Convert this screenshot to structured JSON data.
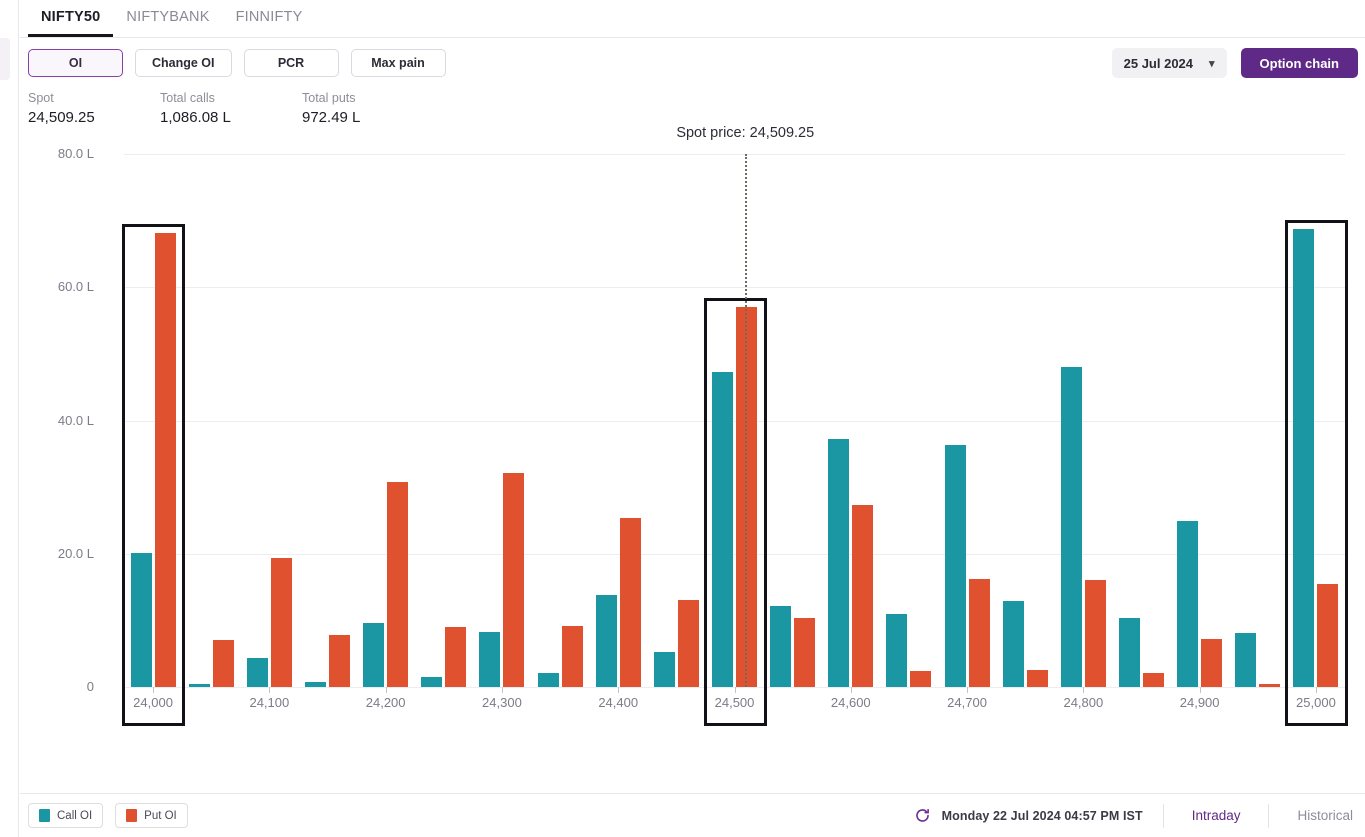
{
  "tabs": [
    {
      "label": "NIFTY50",
      "active": true
    },
    {
      "label": "NIFTYBANK",
      "active": false
    },
    {
      "label": "FINNIFTY",
      "active": false
    }
  ],
  "toolbar": {
    "segments": [
      {
        "label": "OI",
        "active": true
      },
      {
        "label": "Change OI",
        "active": false
      },
      {
        "label": "PCR",
        "active": false
      },
      {
        "label": "Max pain",
        "active": false
      }
    ],
    "date_value": "25 Jul 2024",
    "caret_icon": "chevron-down-icon",
    "option_chain_label": "Option chain"
  },
  "stats": [
    {
      "label": "Spot",
      "value": "24,509.25"
    },
    {
      "label": "Total calls",
      "value": "1,086.08 L"
    },
    {
      "label": "Total puts",
      "value": "972.49 L"
    }
  ],
  "footer": {
    "legend": [
      {
        "label": "Call OI",
        "color": "#1a97a3"
      },
      {
        "label": "Put OI",
        "color": "#e0512f"
      }
    ],
    "refresh_icon": "refresh-icon",
    "timestamp": "Monday 22 Jul 2024 04:57 PM IST",
    "links": [
      {
        "label": "Intraday",
        "active": true
      },
      {
        "label": "Historical",
        "active": false
      }
    ]
  },
  "chart_data": {
    "type": "bar",
    "title": "",
    "xlabel": "",
    "ylabel": "",
    "ylim": [
      0,
      80
    ],
    "yticks": [
      0,
      20,
      40,
      60,
      80
    ],
    "ytick_labels": [
      "0",
      "20.0 L",
      "40.0 L",
      "60.0 L",
      "80.0 L"
    ],
    "grid": true,
    "legend_position": "bottom-left",
    "unit": "L",
    "xtick_labels": [
      "24,000",
      "24,100",
      "24,200",
      "24,300",
      "24,400",
      "24,500",
      "24,600",
      "24,700",
      "24,800",
      "24,900",
      "25,000"
    ],
    "categories": [
      "24,000",
      "24,050",
      "24,100",
      "24,150",
      "24,200",
      "24,250",
      "24,300",
      "24,350",
      "24,400",
      "24,450",
      "24,500",
      "24,550",
      "24,600",
      "24,650",
      "24,700",
      "24,750",
      "24,800",
      "24,850",
      "24,900",
      "24,950",
      "25,000"
    ],
    "series": [
      {
        "name": "Call OI",
        "color": "#1a97a3",
        "values": [
          20.1,
          0.5,
          4.3,
          0.8,
          9.6,
          1.5,
          8.3,
          2.1,
          13.8,
          5.2,
          47.3,
          12.2,
          37.3,
          10.9,
          36.3,
          12.9,
          48.0,
          10.3,
          24.9,
          8.1,
          68.8
        ]
      },
      {
        "name": "Put OI",
        "color": "#e0512f",
        "values": [
          68.1,
          7.1,
          19.3,
          7.8,
          30.7,
          9.0,
          32.1,
          9.2,
          25.3,
          13.0,
          57.1,
          10.3,
          27.3,
          2.4,
          16.2,
          2.5,
          16.0,
          2.1,
          7.2,
          0.5,
          15.4
        ]
      }
    ],
    "spot_marker": {
      "label": "Spot price: 24,509.25",
      "value": 24509.25
    },
    "highlighted_categories": [
      "24,000",
      "24,500",
      "25,000"
    ]
  }
}
